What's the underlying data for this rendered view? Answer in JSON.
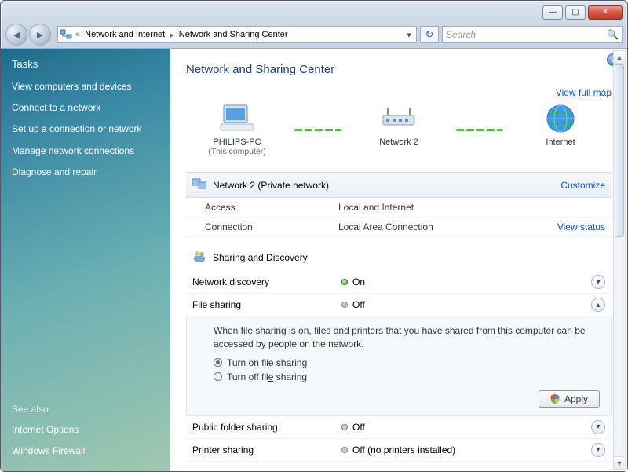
{
  "titlebar": {
    "minimize": "—",
    "maximize": "▢",
    "close": "✕"
  },
  "toolbar": {
    "back": "◄",
    "forward": "►",
    "crumb_parent": "Network and Internet",
    "crumb_current": "Network and Sharing Center",
    "search_placeholder": "Search",
    "refresh": "↻"
  },
  "sidebar": {
    "tasks_title": "Tasks",
    "links": [
      "View computers and devices",
      "Connect to a network",
      "Set up a connection or network",
      "Manage network connections",
      "Diagnose and repair"
    ],
    "see_also_title": "See also",
    "see_also": [
      "Internet Options",
      "Windows Firewall"
    ]
  },
  "main": {
    "help": "?",
    "title": "Network and Sharing Center",
    "view_full_map": "View full map",
    "nodes": {
      "pc_name": "PHILIPS-PC",
      "pc_sub": "(This computer)",
      "net_name": "Network  2",
      "internet": "Internet"
    },
    "network_section": {
      "label": "Network  2 (Private network)",
      "customize": "Customize",
      "rows": [
        {
          "k": "Access",
          "v": "Local and Internet"
        },
        {
          "k": "Connection",
          "v": "Local Area Connection",
          "link": "View status"
        }
      ]
    },
    "sharing": {
      "title": "Sharing and Discovery",
      "rows": [
        {
          "label": "Network discovery",
          "state": "On",
          "dot": "on",
          "expand": "▾"
        },
        {
          "label": "File sharing",
          "state": "Off",
          "dot": "off",
          "expand": "▴"
        },
        {
          "label": "Public folder sharing",
          "state": "Off",
          "dot": "off",
          "expand": "▾"
        },
        {
          "label": "Printer sharing",
          "state": "Off (no printers installed)",
          "dot": "off",
          "expand": "▾"
        }
      ],
      "expanded": {
        "desc": "When file sharing is on, files and printers that you have shared from this computer can be accessed by people on the network.",
        "opt_on": "Turn on file sharing",
        "opt_off": "Turn off file sharing",
        "apply": "Apply"
      }
    }
  }
}
